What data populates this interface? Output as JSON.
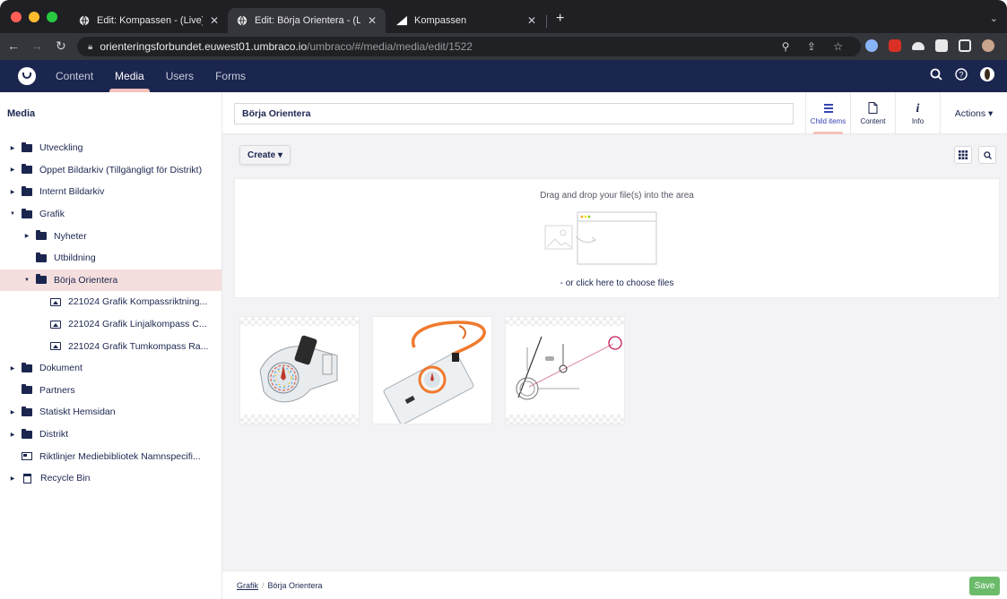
{
  "browser": {
    "tabs": [
      {
        "title": "Edit: Kompassen - (Live) Conte",
        "active": false
      },
      {
        "title": "Edit: Börja Orientera - (Live) M",
        "active": true
      },
      {
        "title": "Kompassen",
        "active": false
      }
    ],
    "new_tab_label": "+",
    "url_host": "orienteringsforbundet.euwest01.umbraco.io",
    "url_path": "/umbraco/#/media/media/edit/1522",
    "traffic_lights": [
      "#ff5f57",
      "#febc2e",
      "#28c840"
    ]
  },
  "header": {
    "nav": [
      "Content",
      "Media",
      "Users",
      "Forms"
    ],
    "active_nav": "Media",
    "icons": [
      "search-icon",
      "help-icon",
      "user-avatar"
    ]
  },
  "sidebar": {
    "title": "Media",
    "items": [
      {
        "label": "Utveckling",
        "level": 0,
        "icon": "folder-icon",
        "expander": "collapsed"
      },
      {
        "label": "Öppet Bildarkiv (Tillgängligt för Distrikt)",
        "level": 0,
        "icon": "folder-icon",
        "expander": "collapsed"
      },
      {
        "label": "Internt Bildarkiv",
        "level": 0,
        "icon": "folder-icon",
        "expander": "collapsed"
      },
      {
        "label": "Grafik",
        "level": 0,
        "icon": "folder-icon",
        "expander": "expanded"
      },
      {
        "label": "Nyheter",
        "level": 1,
        "icon": "folder-icon",
        "expander": "collapsed"
      },
      {
        "label": "Utbildning",
        "level": 1,
        "icon": "folder-icon",
        "expander": "none"
      },
      {
        "label": "Börja Orientera",
        "level": 1,
        "icon": "folder-icon",
        "expander": "expanded",
        "selected": true
      },
      {
        "label": "221024 Grafik Kompassriktning...",
        "level": 2,
        "icon": "image-icon",
        "expander": "none"
      },
      {
        "label": "221024 Grafik Linjalkompass C...",
        "level": 2,
        "icon": "image-icon",
        "expander": "none"
      },
      {
        "label": "221024 Grafik Tumkompass Ra...",
        "level": 2,
        "icon": "image-icon",
        "expander": "none"
      },
      {
        "label": "Dokument",
        "level": 0,
        "icon": "folder-icon",
        "expander": "collapsed"
      },
      {
        "label": "Partners",
        "level": 0,
        "icon": "folder-icon",
        "expander": "none"
      },
      {
        "label": "Statiskt Hemsidan",
        "level": 0,
        "icon": "folder-icon",
        "expander": "collapsed"
      },
      {
        "label": "Distrikt",
        "level": 0,
        "icon": "folder-icon",
        "expander": "collapsed"
      },
      {
        "label": "Riktlinjer Mediebibliotek Namnspecifi...",
        "level": 0,
        "icon": "document-icon",
        "expander": "none"
      },
      {
        "label": "Recycle Bin",
        "level": 0,
        "icon": "trash-icon",
        "expander": "collapsed"
      }
    ]
  },
  "editor": {
    "name_value": "Börja Orientera",
    "apps": [
      {
        "label": "Child items",
        "icon": "list-icon",
        "active": true
      },
      {
        "label": "Content",
        "icon": "document-icon",
        "active": false
      },
      {
        "label": "Info",
        "icon": "info-icon",
        "active": false
      }
    ],
    "actions_label": "Actions ▾",
    "create_label": "Create ▾",
    "dropzone_text": "Drag and drop your file(s) into the area",
    "dropzone_choose": "- or click here to choose files",
    "media_items": [
      "thumb-compass-thumb",
      "thumb-compass-lanyard",
      "thumb-compass-diagram"
    ]
  },
  "footer": {
    "breadcrumb": [
      "Grafik",
      "Börja Orientera"
    ],
    "save_label": "Save"
  },
  "colors": {
    "header_bg": "#1b264f",
    "accent": "#f5c1bc",
    "selected_row": "#f5dede",
    "save_green": "#6cbb6b"
  }
}
